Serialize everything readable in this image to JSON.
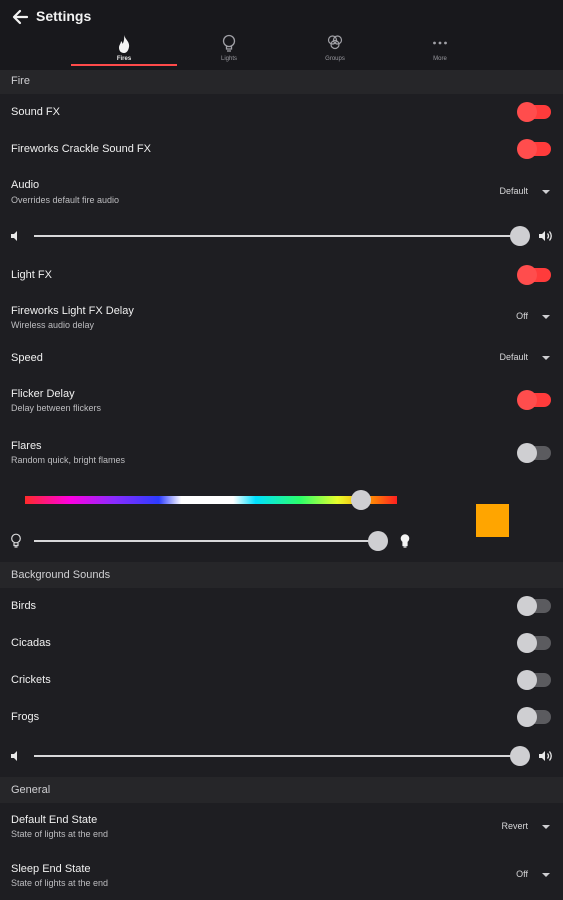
{
  "header": {
    "title": "Settings"
  },
  "tabs": [
    {
      "label": "Fires",
      "icon": "flame-icon",
      "active": true
    },
    {
      "label": "Lights",
      "icon": "lightbulb-icon",
      "active": false
    },
    {
      "label": "Groups",
      "icon": "group-icon",
      "active": false
    },
    {
      "label": "More",
      "icon": "more-icon",
      "active": false
    }
  ],
  "fire": {
    "section_title": "Fire",
    "sound_fx": {
      "label": "Sound FX",
      "on": true
    },
    "fireworks_crackle": {
      "label": "Fireworks Crackle Sound FX",
      "on": true
    },
    "audio": {
      "label": "Audio",
      "sub": "Overrides default fire audio",
      "value": "Default"
    },
    "volume_level": 1.0,
    "light_fx": {
      "label": "Light FX",
      "on": true
    },
    "fireworks_delay": {
      "label": "Fireworks Light FX Delay",
      "sub": "Wireless audio delay",
      "value": "Off"
    },
    "speed": {
      "label": "Speed",
      "value": "Default"
    },
    "flicker_delay": {
      "label": "Flicker Delay",
      "sub": "Delay between flickers",
      "on": true
    },
    "flares": {
      "label": "Flares",
      "sub": "Random quick, bright flames",
      "on": false
    },
    "hue_level": 0.9,
    "brightness_level": 0.98,
    "swatch_color": "#ffa500"
  },
  "background": {
    "section_title": "Background Sounds",
    "birds": {
      "label": "Birds",
      "on": false
    },
    "cicadas": {
      "label": "Cicadas",
      "on": false
    },
    "crickets": {
      "label": "Crickets",
      "on": false
    },
    "frogs": {
      "label": "Frogs",
      "on": false
    },
    "volume_level": 1.0
  },
  "general": {
    "section_title": "General",
    "default_end_state": {
      "label": "Default End State",
      "sub": "State of lights at the end",
      "value": "Revert"
    },
    "sleep_end_state": {
      "label": "Sleep End State",
      "sub": "State of lights at the end",
      "value": "Off"
    }
  },
  "colors": {
    "accent": "#ff3b3b",
    "background": "#1e1e22",
    "section": "#262629"
  }
}
